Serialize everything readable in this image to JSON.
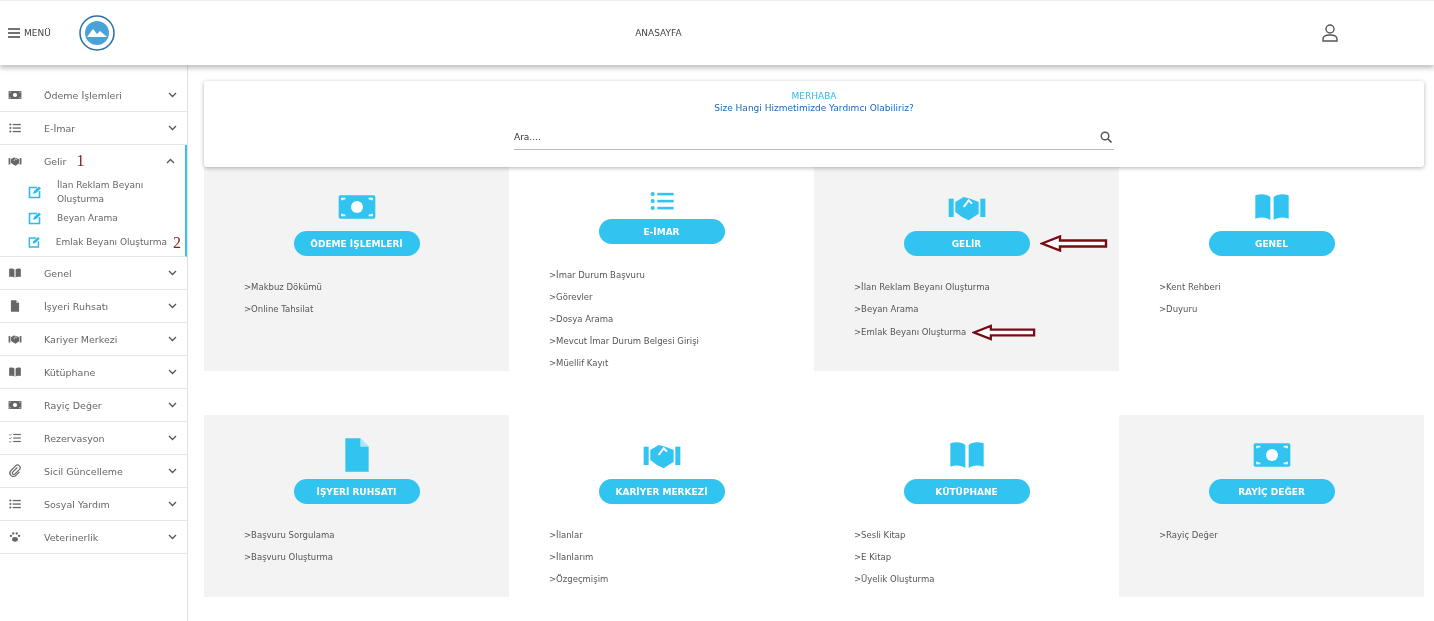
{
  "header": {
    "menu_label": "MENÜ",
    "title": "ANASAYFA"
  },
  "sidebar": {
    "items": [
      {
        "kind": "money",
        "label": "Ödeme İşlemleri",
        "expanded": false
      },
      {
        "kind": "list",
        "label": "E-İmar",
        "expanded": false
      },
      {
        "kind": "handshake",
        "label": "Gelir",
        "expanded": true,
        "annotation": "1",
        "children": [
          {
            "label": "İlan Reklam Beyanı Oluşturma"
          },
          {
            "label": "Beyan Arama"
          },
          {
            "label": "Emlak Beyanı Oluşturma",
            "annotation": "2"
          }
        ]
      },
      {
        "kind": "book",
        "label": "Genel",
        "expanded": false
      },
      {
        "kind": "document",
        "label": "İşyeri Ruhsatı",
        "expanded": false
      },
      {
        "kind": "handshake",
        "label": "Kariyer Merkezi",
        "expanded": false
      },
      {
        "kind": "book",
        "label": "Kütüphane",
        "expanded": false
      },
      {
        "kind": "money",
        "label": "Rayiç Değer",
        "expanded": false
      },
      {
        "kind": "checklist",
        "label": "Rezervasyon",
        "expanded": false
      },
      {
        "kind": "clip",
        "label": "Sicil Güncelleme",
        "expanded": false
      },
      {
        "kind": "list",
        "label": "Sosyal Yardım",
        "expanded": false
      },
      {
        "kind": "paw",
        "label": "Veterinerlik",
        "expanded": false
      }
    ]
  },
  "search": {
    "greeting": "MERHABA",
    "question": "Size Hangi Hizmetimizde Yardımcı Olabiliriz?",
    "placeholder": "Ara...."
  },
  "cards": [
    {
      "kind": "money",
      "title": "ÖDEME İŞLEMLERİ",
      "shaded": true,
      "arrow": false,
      "links": [
        {
          "label": ">Makbuz Dökümü",
          "arrow": false
        },
        {
          "label": ">Online Tahsilat",
          "arrow": false
        }
      ]
    },
    {
      "kind": "list",
      "title": "E-İMAR",
      "shaded": false,
      "arrow": false,
      "links": [
        {
          "label": ">İmar Durum Başvuru",
          "arrow": false
        },
        {
          "label": ">Görevler",
          "arrow": false
        },
        {
          "label": ">Dosya Arama",
          "arrow": false
        },
        {
          "label": ">Mevcut İmar Durum Belgesi Girişi",
          "arrow": false
        },
        {
          "label": ">Müellif Kayıt",
          "arrow": false
        }
      ]
    },
    {
      "kind": "handshake",
      "title": "GELİR",
      "shaded": true,
      "arrow": true,
      "links": [
        {
          "label": ">İlan Reklam Beyanı Oluşturma",
          "arrow": false
        },
        {
          "label": ">Beyan Arama",
          "arrow": false
        },
        {
          "label": ">Emlak Beyanı Oluşturma",
          "arrow": true
        }
      ]
    },
    {
      "kind": "book",
      "title": "GENEL",
      "shaded": false,
      "arrow": false,
      "links": [
        {
          "label": ">Kent Rehberi",
          "arrow": false
        },
        {
          "label": ">Duyuru",
          "arrow": false
        }
      ]
    },
    {
      "kind": "document",
      "title": "İŞYERİ RUHSATI",
      "shaded": true,
      "arrow": false,
      "links": [
        {
          "label": ">Başvuru Sorgulama",
          "arrow": false
        },
        {
          "label": ">Başvuru Oluşturma",
          "arrow": false
        }
      ]
    },
    {
      "kind": "handshake",
      "title": "KARİYER MERKEZİ",
      "shaded": false,
      "arrow": false,
      "links": [
        {
          "label": ">İlanlar",
          "arrow": false
        },
        {
          "label": ">İlanlarım",
          "arrow": false
        },
        {
          "label": ">Özgeçmişim",
          "arrow": false
        }
      ]
    },
    {
      "kind": "book",
      "title": "KÜTÜPHANE",
      "shaded": false,
      "arrow": false,
      "links": [
        {
          "label": ">Sesli Kitap",
          "arrow": false
        },
        {
          "label": ">E Kitap",
          "arrow": false
        },
        {
          "label": ">Üyelik Oluşturma",
          "arrow": false
        }
      ]
    },
    {
      "kind": "money",
      "title": "RAYİÇ DEĞER",
      "shaded": true,
      "arrow": false,
      "links": [
        {
          "label": ">Rayiç Değer",
          "arrow": false
        }
      ]
    }
  ]
}
